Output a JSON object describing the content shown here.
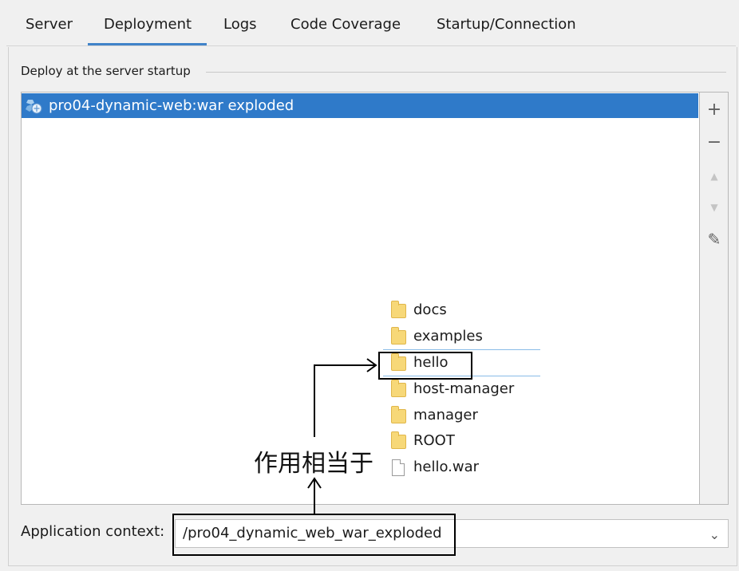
{
  "tabs": [
    {
      "label": "Server"
    },
    {
      "label": "Deployment"
    },
    {
      "label": "Logs"
    },
    {
      "label": "Code Coverage"
    },
    {
      "label": "Startup/Connection"
    }
  ],
  "active_tab": "Deployment",
  "deploy_group": {
    "title": "Deploy at the server startup",
    "items": [
      {
        "label": "pro04-dynamic-web:war exploded",
        "selected": true
      }
    ]
  },
  "toolbar": {
    "add_icon": "+",
    "remove_icon": "−",
    "up_icon": "▲",
    "down_icon": "▼",
    "edit_icon": "✎"
  },
  "overlay": {
    "tree": [
      {
        "label": "docs",
        "icon": "folder-icon"
      },
      {
        "label": "examples",
        "icon": "folder-icon"
      },
      {
        "label": "hello",
        "icon": "folder-icon",
        "highlighted": true
      },
      {
        "label": "host-manager",
        "icon": "folder-icon"
      },
      {
        "label": "manager",
        "icon": "folder-icon"
      },
      {
        "label": "ROOT",
        "icon": "folder-icon"
      },
      {
        "label": "hello.war",
        "icon": "file-icon"
      }
    ],
    "annotation_text": "作用相当于"
  },
  "app_context": {
    "label": "Application context:",
    "value": "/pro04_dynamic_web_war_exploded"
  },
  "colors": {
    "accent": "#4083c9",
    "selection": "#2f7ac9",
    "folder": "#f7d878"
  }
}
